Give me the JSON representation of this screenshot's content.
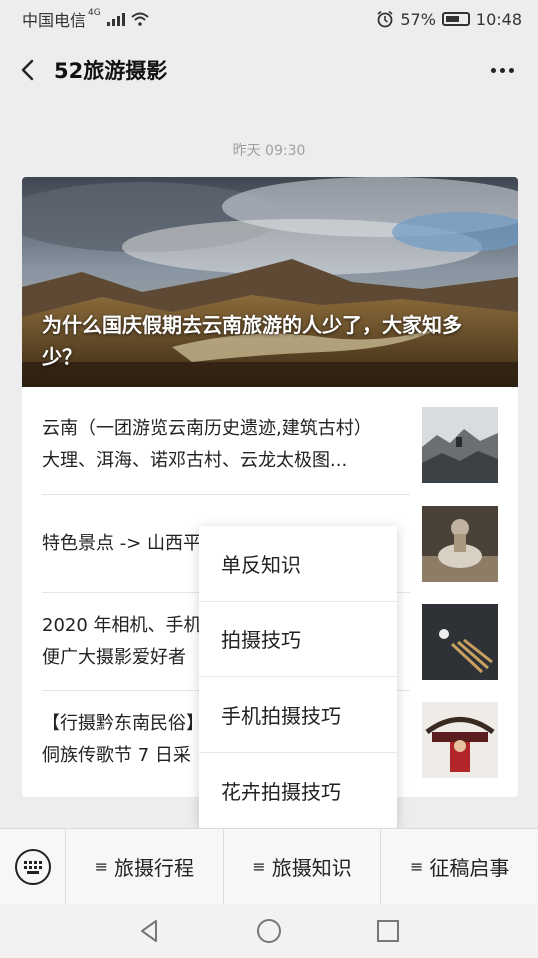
{
  "status": {
    "carrier": "中国电信",
    "network": "4G",
    "battery": "57%",
    "time": "10:48"
  },
  "nav": {
    "title": "52旅游摄影"
  },
  "timestamp": "昨天 09:30",
  "hero": {
    "title": "为什么国庆假期去云南旅游的人少了，大家知多少？"
  },
  "articles": [
    {
      "line1": "云南（一团游览云南历史遗迹,建筑古村）",
      "line2": "大理、洱海、诺邓古村、云龙太极图..."
    },
    {
      "line1": "特色景点 -> 山西平",
      "line2": ""
    },
    {
      "line1": "2020 年相机、手机",
      "line2": "便广大摄影爱好者"
    },
    {
      "line1": "【行摄黔东南民俗】",
      "line2": "侗族传歌节 7 日采"
    }
  ],
  "popup": {
    "items": [
      "单反知识",
      "拍摄技巧",
      "手机拍摄技巧",
      "花卉拍摄技巧"
    ]
  },
  "bottom_menu": {
    "items": [
      "旅摄行程",
      "旅摄知识",
      "征稿启事"
    ]
  },
  "icons": {
    "back": "back-arrow-icon",
    "more": "more-dots-icon",
    "keyboard": "keyboard-icon",
    "menu": "hamburger-icon"
  }
}
